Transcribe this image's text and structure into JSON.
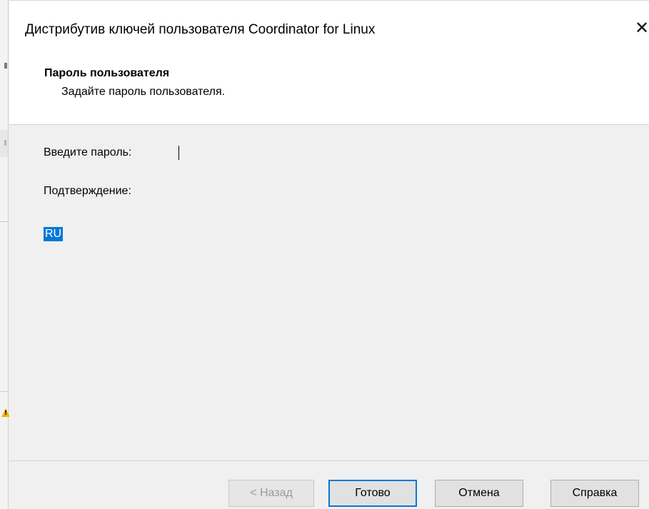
{
  "dialog": {
    "title": "Дистрибутив ключей пользователя Coordinator for Linux",
    "close_glyph": "✕"
  },
  "header": {
    "title": "Пароль пользователя",
    "subtitle": "Задайте пароль пользователя."
  },
  "form": {
    "password_label": "Введите пароль:",
    "password_value": "",
    "confirm_label": "Подтверждение:",
    "confirm_value": ""
  },
  "input_language": "RU",
  "buttons": {
    "back": "< Назад",
    "finish": "Готово",
    "cancel": "Отмена",
    "help": "Справка"
  },
  "colors": {
    "accent": "#0078d7",
    "dialog_bg": "#f0f0f0",
    "header_bg": "#ffffff"
  }
}
